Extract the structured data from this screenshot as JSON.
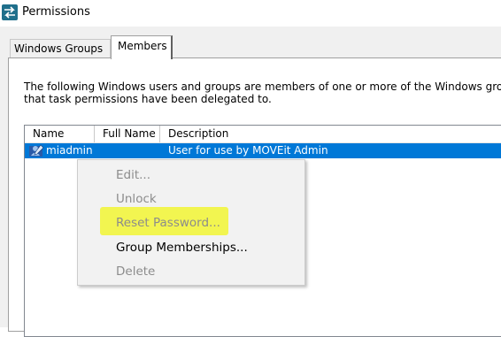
{
  "window": {
    "title": "Permissions",
    "icon": "swap-arrows-icon"
  },
  "tabs": [
    {
      "label": "Windows Groups",
      "selected": false
    },
    {
      "label": "Members",
      "selected": true
    }
  ],
  "description": {
    "line1": "The following Windows users and groups are members of one or more of the Windows group",
    "line2": "that task permissions have been delegated to."
  },
  "list": {
    "columns": [
      "Name",
      "Full Name",
      "Description"
    ],
    "rows": [
      {
        "name": "miadmin",
        "full_name": "",
        "description": "User for use by MOVEit Admin",
        "selected": true,
        "icon": "user-icon"
      }
    ]
  },
  "context_menu": {
    "items": [
      {
        "label": "Edit...",
        "enabled": false
      },
      {
        "label": "Unlock",
        "enabled": false
      },
      {
        "label": "Reset Password...",
        "enabled": false,
        "highlighted": true
      },
      {
        "label": "Group Memberships...",
        "enabled": true
      },
      {
        "label": "Delete",
        "enabled": false
      }
    ]
  },
  "colors": {
    "selection": "#0078d7",
    "highlight": "#f2f542",
    "disabled_text": "#8c8c8c"
  }
}
